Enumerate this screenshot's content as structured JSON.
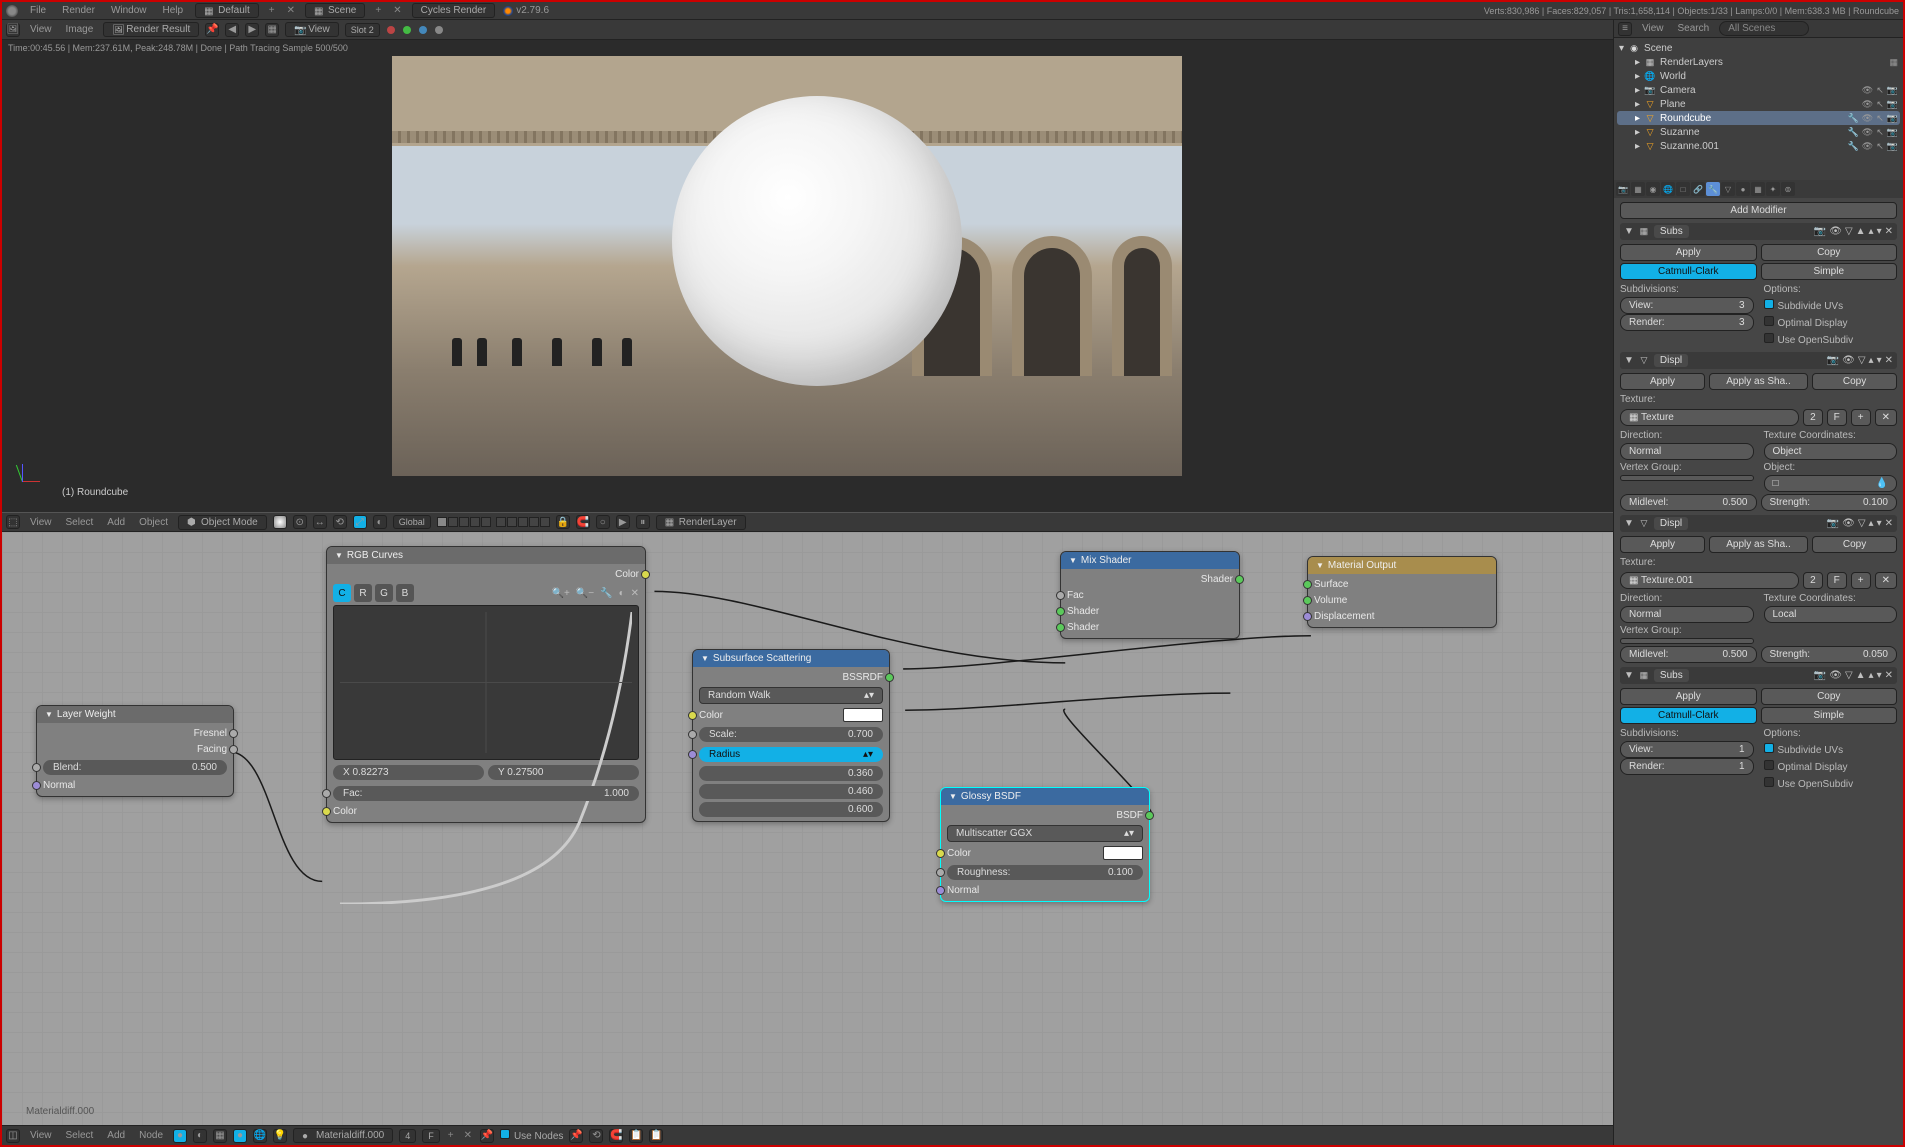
{
  "topbar": {
    "menus": [
      "File",
      "Render",
      "Window",
      "Help"
    ],
    "layout_default": "Default",
    "layout_scene": "Scene",
    "engine": "Cycles Render",
    "version": "v2.79.6",
    "stats": "Verts:830,986 | Faces:829,057 | Tris:1,658,114 | Objects:1/33 | Lamps:0/0 | Mem:638.3 MB | Roundcube"
  },
  "image_editor": {
    "menus": [
      "View",
      "Image"
    ],
    "image_name": "Render Result",
    "slot": "Slot 2",
    "view_label": "View",
    "render_info": "Time:00:45.56 | Mem:237.61M, Peak:248.78M | Done | Path Tracing Sample 500/500",
    "active_object": "(1) Roundcube"
  },
  "viewport_header": {
    "menus": [
      "View",
      "Select",
      "Add",
      "Object"
    ],
    "mode": "Object Mode",
    "orientation": "Global",
    "renderlayer": "RenderLayer"
  },
  "outliner": {
    "menus": [
      "View",
      "Search"
    ],
    "scope": "All Scenes",
    "scene": "Scene",
    "items": [
      {
        "name": "RenderLayers",
        "type": "layers"
      },
      {
        "name": "World",
        "type": "world"
      },
      {
        "name": "Camera",
        "type": "camera"
      },
      {
        "name": "Plane",
        "type": "mesh"
      },
      {
        "name": "Roundcube",
        "type": "mesh",
        "selected": true
      },
      {
        "name": "Suzanne",
        "type": "mesh"
      },
      {
        "name": "Suzanne.001",
        "type": "mesh"
      }
    ]
  },
  "properties": {
    "add_modifier": "Add Modifier",
    "apply": "Apply",
    "apply_as_shape": "Apply as Sha..",
    "copy": "Copy",
    "mod1": {
      "name": "Subs",
      "catmull": "Catmull-Clark",
      "simple": "Simple",
      "subdivisions_label": "Subdivisions:",
      "options_label": "Options:",
      "view_label": "View:",
      "view": "3",
      "render_label": "Render:",
      "render": "3",
      "opt_subdivide": "Subdivide UVs",
      "opt_optimal": "Optimal Display",
      "opt_opensubdiv": "Use OpenSubdiv"
    },
    "mod2": {
      "name": "Displ",
      "texture_label": "Texture:",
      "texture": "Texture",
      "tex_num": "2",
      "direction_label": "Direction:",
      "texcoord_label": "Texture Coordinates:",
      "direction": "Normal",
      "texcoord": "Object",
      "vgroup_label": "Vertex Group:",
      "object_label": "Object:",
      "midlevel_label": "Midlevel:",
      "midlevel": "0.500",
      "strength_label": "Strength:",
      "strength": "0.100"
    },
    "mod3": {
      "name": "Displ",
      "texture": "Texture.001",
      "tex_num": "2",
      "direction": "Normal",
      "texcoord": "Local",
      "midlevel": "0.500",
      "strength": "0.050"
    },
    "mod4": {
      "name": "Subs",
      "view": "1",
      "render": "1"
    }
  },
  "node_editor": {
    "footer_menus": [
      "View",
      "Select",
      "Add",
      "Node"
    ],
    "material": "Materialdiff.000",
    "mat_users": "4",
    "use_nodes": "Use Nodes",
    "backdrop_label": "Materialdiff.000"
  },
  "nodes": {
    "layer_weight": {
      "title": "Layer Weight",
      "fresnel": "Fresnel",
      "facing": "Facing",
      "blend_label": "Blend:",
      "blend": "0.500",
      "normal": "Normal"
    },
    "rgb_curves": {
      "title": "RGB Curves",
      "color_out": "Color",
      "tabs": [
        "C",
        "R",
        "G",
        "B"
      ],
      "x_label": "X",
      "x": "0.82273",
      "y_label": "Y",
      "y": "0.27500",
      "fac_label": "Fac:",
      "fac": "1.000",
      "color_in": "Color"
    },
    "sss": {
      "title": "Subsurface Scattering",
      "bssrdf": "BSSRDF",
      "method": "Random Walk",
      "color": "Color",
      "scale_label": "Scale:",
      "scale": "0.700",
      "radius": "Radius",
      "r1": "0.360",
      "r2": "0.460",
      "r3": "0.600"
    },
    "glossy": {
      "title": "Glossy BSDF",
      "bsdf": "BSDF",
      "method": "Multiscatter GGX",
      "color": "Color",
      "roughness_label": "Roughness:",
      "roughness": "0.100",
      "normal": "Normal"
    },
    "mix": {
      "title": "Mix Shader",
      "shader_out": "Shader",
      "fac": "Fac",
      "shader1": "Shader",
      "shader2": "Shader"
    },
    "output": {
      "title": "Material Output",
      "surface": "Surface",
      "volume": "Volume",
      "displacement": "Displacement"
    }
  }
}
